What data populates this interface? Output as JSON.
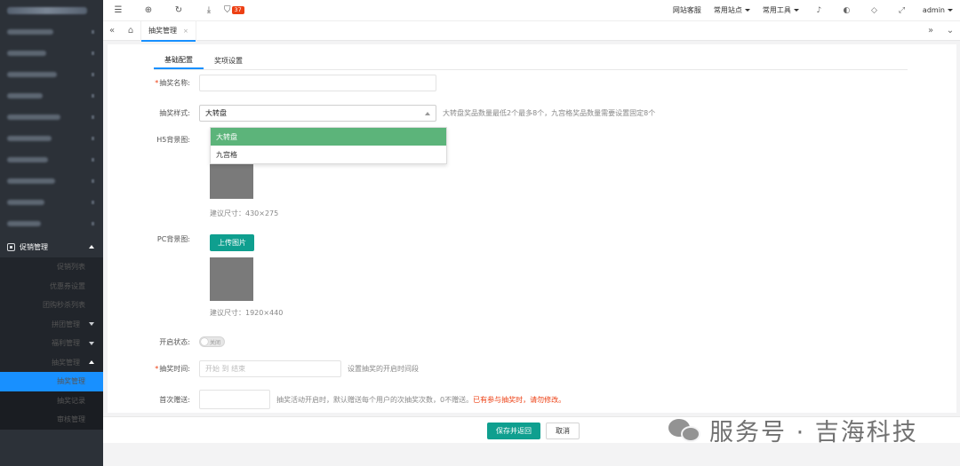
{
  "topbar": {
    "badge_count": "37",
    "links": [
      "网站客服",
      "常用站点",
      "常用工具"
    ],
    "user": "admin"
  },
  "tabs": {
    "active_tab": "抽奖管理",
    "close_glyph": "×"
  },
  "sidebar": {
    "group": "促销管理",
    "items": [
      {
        "label": "促销列表"
      },
      {
        "label": "优惠券设置"
      },
      {
        "label": "团购秒杀列表"
      },
      {
        "label": "拼团管理"
      },
      {
        "label": "福利管理"
      },
      {
        "label": "抽奖管理"
      }
    ],
    "subitems": [
      {
        "label": "抽奖管理"
      },
      {
        "label": "抽奖记录"
      },
      {
        "label": "审核管理"
      }
    ]
  },
  "form": {
    "tabs": [
      "基础配置",
      "奖项设置"
    ],
    "required_mark": "*",
    "name_label": "抽奖名称:",
    "name_value": "",
    "style_label": "抽奖样式:",
    "style_value": "大转盘",
    "style_hint": "大转盘奖品数量最低2个最多8个，九宫格奖品数量需要设置固定8个",
    "style_options": [
      "大转盘",
      "九宫格"
    ],
    "h5_label": "H5背景图:",
    "h5_note": "建议尺寸：430×275",
    "pc_label": "PC背景图:",
    "upload_label": "上传图片",
    "pc_note": "建议尺寸：1920×440",
    "status_label": "开启状态:",
    "status_value": "关闭",
    "time_label": "抽奖时间:",
    "time_placeholder": "开始 到 结束",
    "time_hint": "设置抽奖的开启时间段",
    "free_label": "首次赠送:",
    "free_hint": "抽奖活动开启时，默认赠送每个用户的次抽奖次数，0不赠送。",
    "free_warning": "已有参与抽奖时，请勿修改。"
  },
  "footer": {
    "save_label": "保存并返回",
    "cancel_label": "取消"
  },
  "watermark": {
    "text": "服务号 · 吉海科技"
  },
  "colors": {
    "sidebar_bg": "#2c3138",
    "active_blue": "#1890ff",
    "primary_teal": "#0f9f8f",
    "option_green": "#5cb47a",
    "warning_red": "#ed4014"
  }
}
